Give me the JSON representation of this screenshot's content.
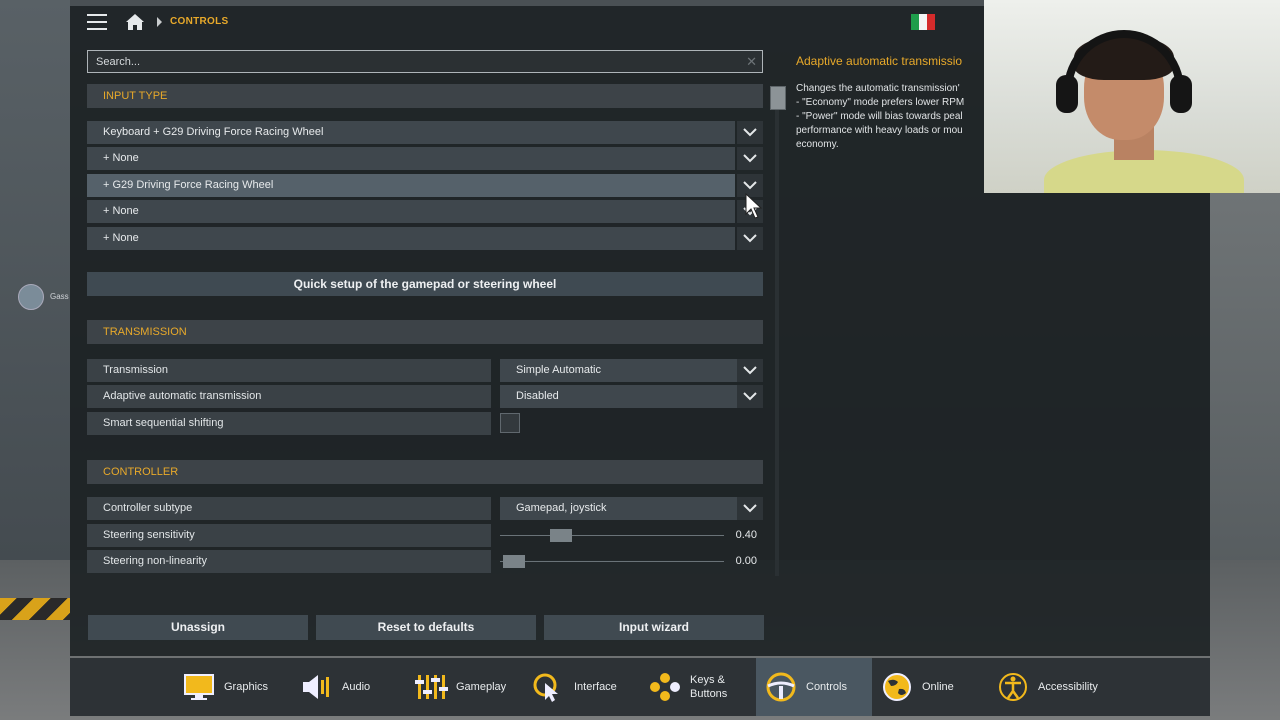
{
  "breadcrumb": {
    "current": "CONTROLS"
  },
  "search": {
    "placeholder": "Search..."
  },
  "sections": {
    "input_type": "INPUT TYPE",
    "transmission": "TRANSMISSION",
    "controller": "CONTROLLER"
  },
  "input_rows": [
    "Keyboard + G29 Driving Force Racing Wheel",
    "+ None",
    "+ G29 Driving Force Racing Wheel",
    "+ None",
    "+ None"
  ],
  "quick_setup": "Quick setup of the gamepad or steering wheel",
  "transmission": {
    "transmission_label": "Transmission",
    "transmission_value": "Simple Automatic",
    "adaptive_label": "Adaptive automatic transmission",
    "adaptive_value": "Disabled",
    "smart_label": "Smart sequential shifting",
    "smart_checked": false
  },
  "controller": {
    "subtype_label": "Controller subtype",
    "subtype_value": "Gamepad, joystick",
    "sensitivity_label": "Steering sensitivity",
    "sensitivity_value": "0.40",
    "nonlinearity_label": "Steering non-linearity",
    "nonlinearity_value": "0.00"
  },
  "info": {
    "title": "Adaptive automatic transmissio",
    "body": "Changes the automatic transmission'\n- \"Economy\" mode prefers lower RPM\n- \"Power\" mode will bias towards peal\nperformance with heavy loads or mou\neconomy."
  },
  "buttons": {
    "unassign": "Unassign",
    "reset": "Reset to defaults",
    "wizard": "Input wizard"
  },
  "nav": [
    {
      "label": "Graphics",
      "icon": "monitor-icon"
    },
    {
      "label": "Audio",
      "icon": "speaker-icon"
    },
    {
      "label": "Gameplay",
      "icon": "sliders-icon"
    },
    {
      "label": "Interface",
      "icon": "cursor-icon"
    },
    {
      "label": "Keys &\nButtons",
      "icon": "gamepad-buttons-icon"
    },
    {
      "label": "Controls",
      "icon": "steering-wheel-icon",
      "active": true
    },
    {
      "label": "Online",
      "icon": "globe-icon"
    },
    {
      "label": "Accessibility",
      "icon": "accessibility-icon"
    }
  ],
  "side_overlay": {
    "note": "Gass"
  },
  "colors": {
    "accent": "#e8a92a",
    "panel": "#3f474d",
    "highlight": "#55616a"
  }
}
